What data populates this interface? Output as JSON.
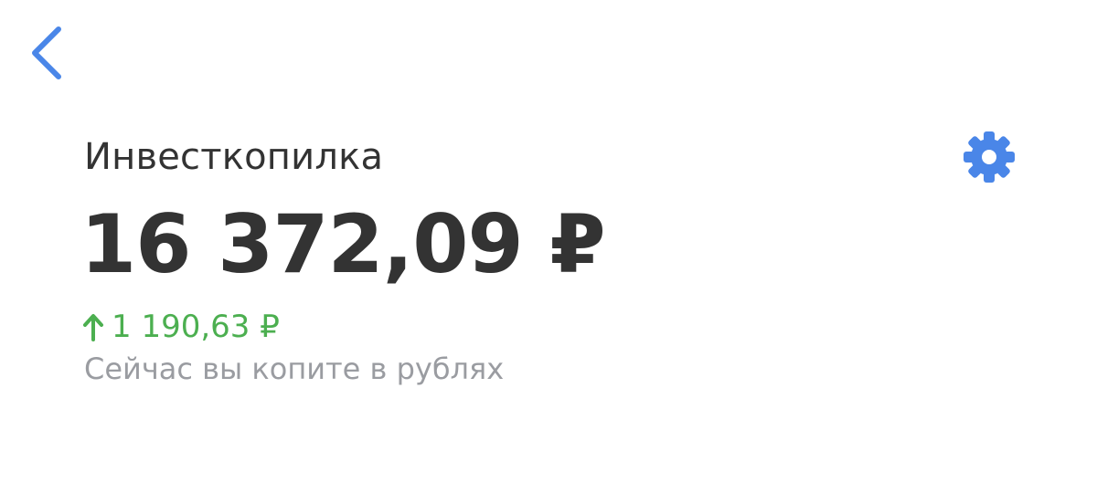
{
  "nav": {
    "back_icon": "chevron-left-icon",
    "settings_icon": "gear-icon"
  },
  "account": {
    "title": "Инвесткопилка",
    "balance": "16 372,09 ₽",
    "change_amount": "1 190,63 ₽",
    "change_direction": "up",
    "savings_note": "Сейчас вы копите в рублях"
  },
  "colors": {
    "accent": "#4a86e8",
    "text_primary": "#333333",
    "positive": "#4caf50",
    "text_secondary": "#9a9ca1",
    "background": "#ffffff"
  }
}
